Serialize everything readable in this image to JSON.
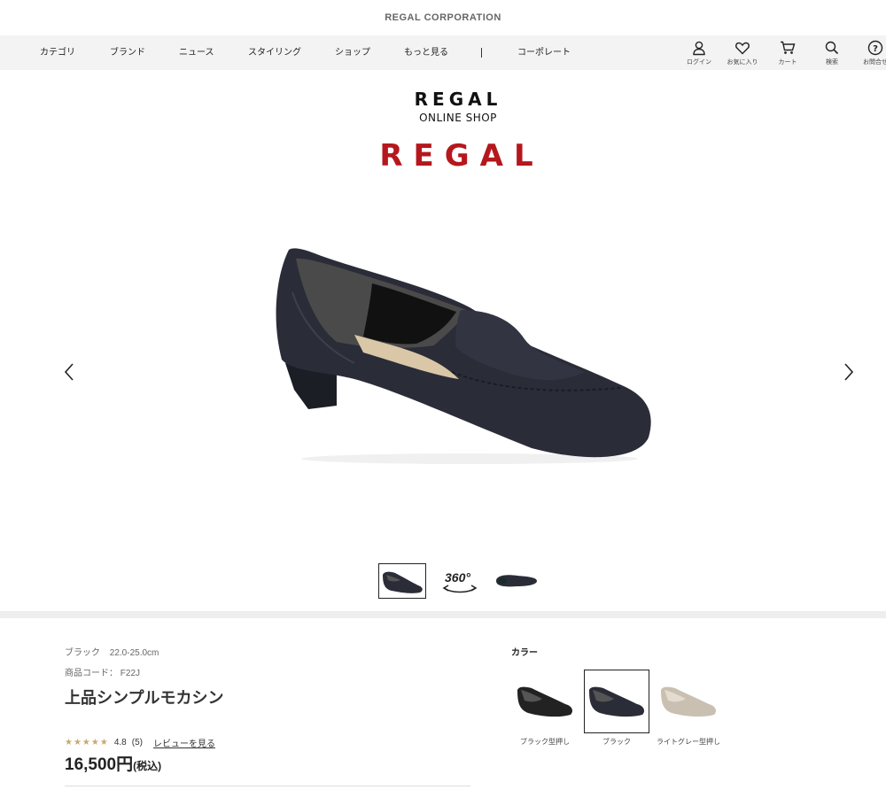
{
  "corp": {
    "title": "REGAL CORPORATION"
  },
  "nav": {
    "items": [
      "カテゴリ",
      "ブランド",
      "ニュース",
      "スタイリング",
      "ショップ",
      "もっと見る",
      "コーポレート"
    ],
    "separator": "|",
    "icons": [
      {
        "label": "ログイン",
        "icon": "user-icon"
      },
      {
        "label": "お気に入り",
        "icon": "heart-icon"
      },
      {
        "label": "カート",
        "icon": "cart-icon"
      },
      {
        "label": "検索",
        "icon": "search-icon"
      },
      {
        "label": "お問合せ",
        "icon": "help-icon"
      }
    ]
  },
  "logo": {
    "top": "REGAL",
    "sub": "ONLINE SHOP",
    "brand": "REGAL",
    "brand_color": "#b5171d"
  },
  "gallery": {
    "thumb_360_label": "360°"
  },
  "product": {
    "color": "ブラック",
    "size_range": "22.0-25.0cm",
    "code_label": "商品コード：",
    "code": "F22J",
    "title": "上品シンプルモカシン",
    "stars": "★★★★★",
    "rating": "4.8",
    "review_count": "(5)",
    "review_link": "レビューを見る",
    "price": "16,500円",
    "tax": "(税込)"
  },
  "colors": {
    "heading": "カラー",
    "options": [
      {
        "label": "ブラック型押し",
        "selected": false
      },
      {
        "label": "ブラック",
        "selected": true
      },
      {
        "label": "ライトグレー型押し",
        "selected": false
      }
    ]
  }
}
